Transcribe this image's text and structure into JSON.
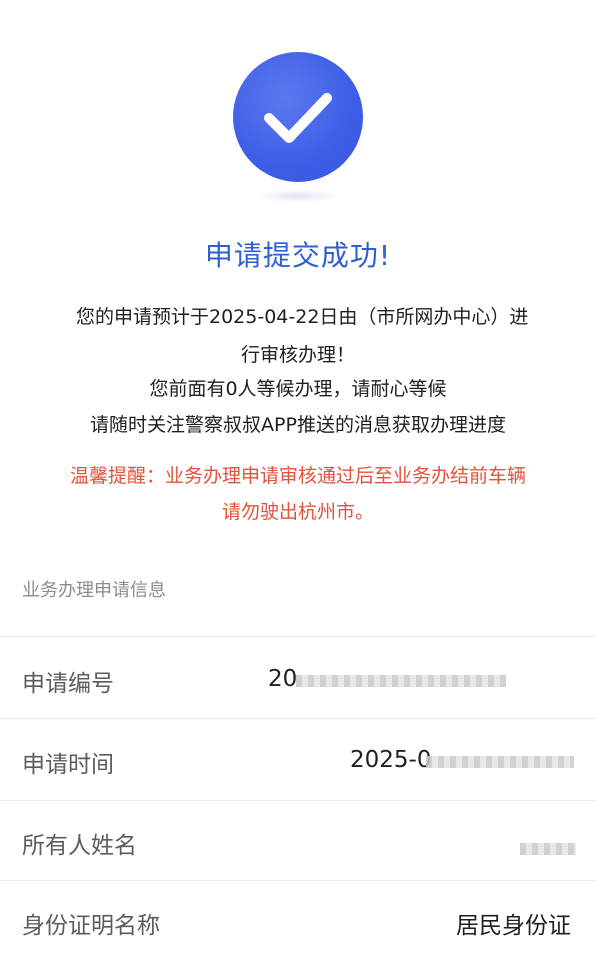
{
  "status": {
    "icon": "check-circle-icon",
    "title": "申请提交成功!"
  },
  "message": {
    "line1": "您的申请预计于2025-04-22日由（市所网办中心）进",
    "line2": "行审核办理！",
    "line3": "您前面有0人等候办理，请耐心等候",
    "line4": "请随时关注警察叔叔APP推送的消息获取办理进度"
  },
  "notice": {
    "line1": "温馨提醒：业务办理申请审核通过后至业务办结前车辆",
    "line2": "请勿驶出杭州市。"
  },
  "info_section": {
    "title": "业务办理申请信息",
    "rows": [
      {
        "label": "申请编号",
        "value": "20"
      },
      {
        "label": "申请时间",
        "value": "2025-0"
      },
      {
        "label": "所有人姓名",
        "value": ""
      },
      {
        "label": "身份证明名称",
        "value": "居民身份证"
      }
    ]
  },
  "colors": {
    "accent": "#3d5ee6",
    "title": "#2f5fd2",
    "notice": "#e2533b"
  }
}
